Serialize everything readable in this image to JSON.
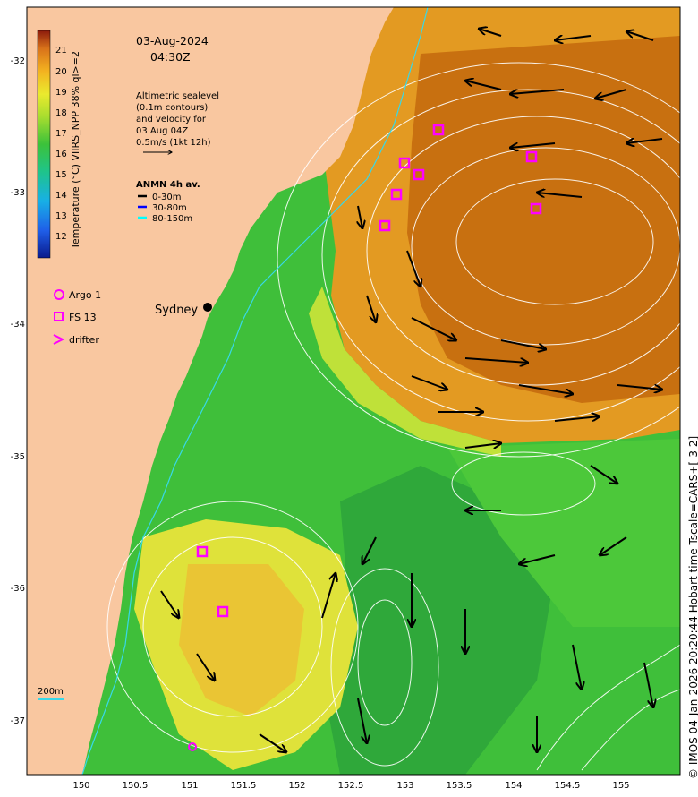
{
  "title": {
    "date": "03-Aug-2024",
    "time": "04:30Z"
  },
  "altimetry_note": [
    "Altimetric sealevel",
    "(0.1m contours)",
    "and velocity for",
    "03 Aug 04Z",
    "0.5m/s (1kt 12h)"
  ],
  "anmn": {
    "title": "ANMN 4h av.",
    "items": [
      {
        "label": "0-30m",
        "color": "#000000"
      },
      {
        "label": "30-80m",
        "color": "#0000ff"
      },
      {
        "label": "80-150m",
        "color": "#00ffff"
      }
    ]
  },
  "markers": {
    "argo_label": "Argo 1",
    "fs_label": "FS 13",
    "drifter_label": "drifter",
    "color": "#ff00ff"
  },
  "city": "Sydney",
  "isobath_label": "200m",
  "colorbar": {
    "label": "Temperature (°C) VIIRS_NPP 38% ql>=2",
    "ticks": [
      "21",
      "20",
      "19",
      "18",
      "17",
      "16",
      "15",
      "14",
      "13",
      "12"
    ]
  },
  "axes": {
    "x_ticks": [
      "150",
      "150.5",
      "151",
      "151.5",
      "152",
      "152.5",
      "153",
      "153.5",
      "154",
      "154.5",
      "155"
    ],
    "y_ticks": [
      "-32",
      "-33",
      "-34",
      "-35",
      "-36",
      "-37"
    ]
  },
  "credit": "© IMOS 04-Jan-2026 20:20:44 Hobart time Tscale=CARS+[-3 2]",
  "colors": {
    "land": "#f9c7a0",
    "warm_core": "#c87010",
    "warm_outer": "#e39a22",
    "green": "#3fbf3a",
    "yellow": "#d6e63a",
    "marker": "#ff00ff"
  }
}
